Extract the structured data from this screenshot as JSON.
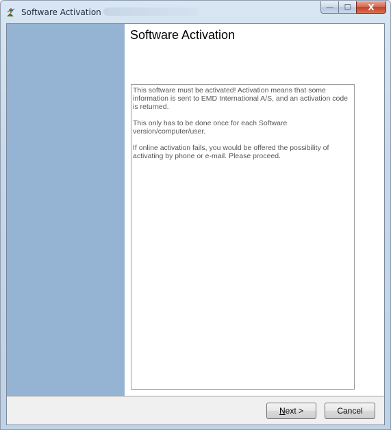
{
  "window": {
    "title": "Software Activation",
    "icon": "wind-turbine-app-icon",
    "caption_buttons": {
      "minimize": "—",
      "maximize": "☐",
      "close": "X"
    }
  },
  "heading": "Software Activation",
  "message": {
    "paragraphs": [
      "This software must be activated! Activation means that some information is sent to EMD International A/S, and an activation code is returned.",
      "This only has to be done once for each Software version/computer/user.",
      "If online activation fails, you would be offered the possibility of activating by phone or e-mail. Please proceed."
    ]
  },
  "buttons": {
    "next_mnemonic": "N",
    "next_rest": "ext >",
    "cancel": "Cancel"
  },
  "colors": {
    "side_panel": "#95b3d2",
    "close_button": "#c2412a"
  }
}
